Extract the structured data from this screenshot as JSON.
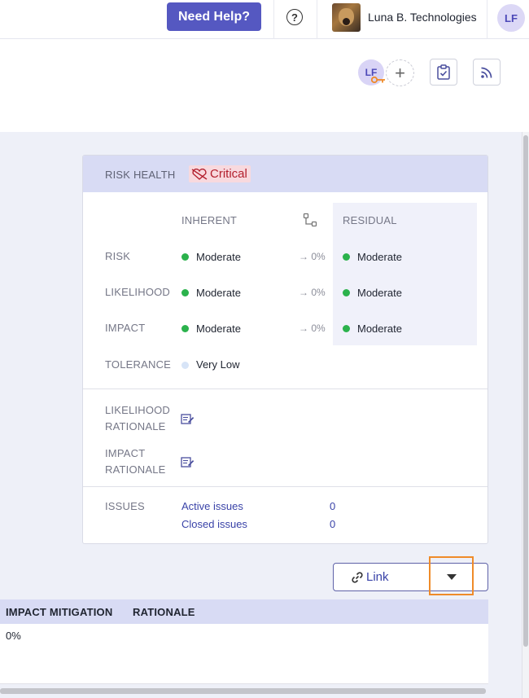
{
  "topbar": {
    "help_label": "Need Help?",
    "help_icon": "question-circle-icon",
    "org_name": "Luna B. Technologies",
    "user_initials": "LF"
  },
  "toolbar": {
    "owner_initials": "LF",
    "add_icon": "plus-icon",
    "task_icon": "clipboard-check-icon",
    "feed_icon": "rss-icon"
  },
  "risk_health": {
    "title": "RISK HEALTH",
    "status": "Critical",
    "status_color": "#b3202e",
    "columns": {
      "inherent": "INHERENT",
      "residual": "RESIDUAL"
    },
    "rows": [
      {
        "label": "RISK",
        "inherent": "Moderate",
        "mitigation": "→ 0%",
        "residual": "Moderate"
      },
      {
        "label": "LIKELIHOOD",
        "inherent": "Moderate",
        "mitigation": "→ 0%",
        "residual": "Moderate"
      },
      {
        "label": "IMPACT",
        "inherent": "Moderate",
        "mitigation": "→ 0%",
        "residual": "Moderate"
      }
    ],
    "tolerance": {
      "label": "TOLERANCE",
      "value": "Very Low"
    },
    "rationale": [
      {
        "label_line1": "LIKELIHOOD",
        "label_line2": "RATIONALE"
      },
      {
        "label_line1": "IMPACT",
        "label_line2": "RATIONALE"
      }
    ],
    "issues": {
      "label": "ISSUES",
      "active_label": "Active issues",
      "active_count": "0",
      "closed_label": "Closed issues",
      "closed_count": "0"
    },
    "status_dot_color": "#2bb24c"
  },
  "link_button": {
    "label": "Link"
  },
  "table": {
    "headers": [
      "IMPACT MITIGATION",
      "RATIONALE"
    ],
    "rows": [
      {
        "impact_mitigation": "0%",
        "rationale": ""
      }
    ]
  }
}
